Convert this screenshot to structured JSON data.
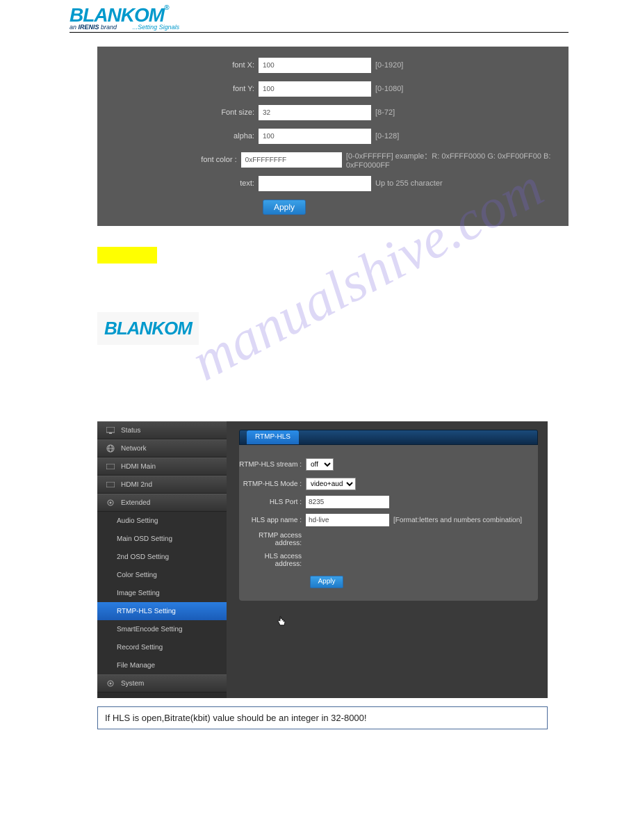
{
  "header": {
    "logo": "BLANKOM",
    "reg": "®",
    "subline_prefix": "an ",
    "subline_bold": "IRENIS",
    "subline_suffix": " brand",
    "script": "...Setting Signals"
  },
  "panel1": {
    "rows": [
      {
        "label": "font X:",
        "value": "100",
        "hint": "[0-1920]"
      },
      {
        "label": "font Y:",
        "value": "100",
        "hint": "[0-1080]"
      },
      {
        "label": "Font size:",
        "value": "32",
        "hint": "[8-72]"
      },
      {
        "label": "alpha:",
        "value": "100",
        "hint": "[0-128]"
      },
      {
        "label": "font color :",
        "value": "0xFFFFFFFF",
        "hint": "[0-0xFFFFFF] example：R: 0xFFFF0000 G: 0xFF00FF00 B: 0xFF0000FF"
      },
      {
        "label": "text:",
        "value": "",
        "hint": "Up to 255 character"
      }
    ],
    "apply": "Apply"
  },
  "logo2": "BLANKOM",
  "watermark": "manualshive.com",
  "sidebar": {
    "items": [
      {
        "label": "Status",
        "icon": "monitor-icon"
      },
      {
        "label": "Network",
        "icon": "globe-icon"
      },
      {
        "label": "HDMI Main",
        "icon": "hdmi-icon"
      },
      {
        "label": "HDMI 2nd",
        "icon": "hdmi-icon"
      },
      {
        "label": "Extended",
        "icon": "gear-icon"
      }
    ],
    "subs": [
      "Audio Setting",
      "Main OSD Setting",
      "2nd OSD Setting",
      "Color Setting",
      "Image Setting",
      "RTMP-HLS Setting",
      "SmartEncode Setting",
      "Record Setting",
      "File Manage"
    ],
    "active_sub_index": 5,
    "system": {
      "label": "System",
      "icon": "gear-icon"
    }
  },
  "panel2": {
    "tab": "RTMP-HLS",
    "rows": [
      {
        "label": "RTMP-HLS stream :",
        "type": "select",
        "value": "off",
        "hint": ""
      },
      {
        "label": "RTMP-HLS Mode :",
        "type": "select",
        "value": "video+audio",
        "hint": ""
      },
      {
        "label": "HLS Port :",
        "type": "input",
        "value": "8235",
        "hint": ""
      },
      {
        "label": "HLS app name :",
        "type": "input",
        "value": "hd-live",
        "hint": "[Format:letters and numbers combination]"
      },
      {
        "label": "RTMP access address:",
        "type": "text",
        "value": "",
        "hint": ""
      },
      {
        "label": "HLS access address:",
        "type": "text",
        "value": "",
        "hint": ""
      }
    ],
    "apply": "Apply"
  },
  "note": "If HLS is open,Bitrate(kbit) value should be an integer in 32-8000!"
}
